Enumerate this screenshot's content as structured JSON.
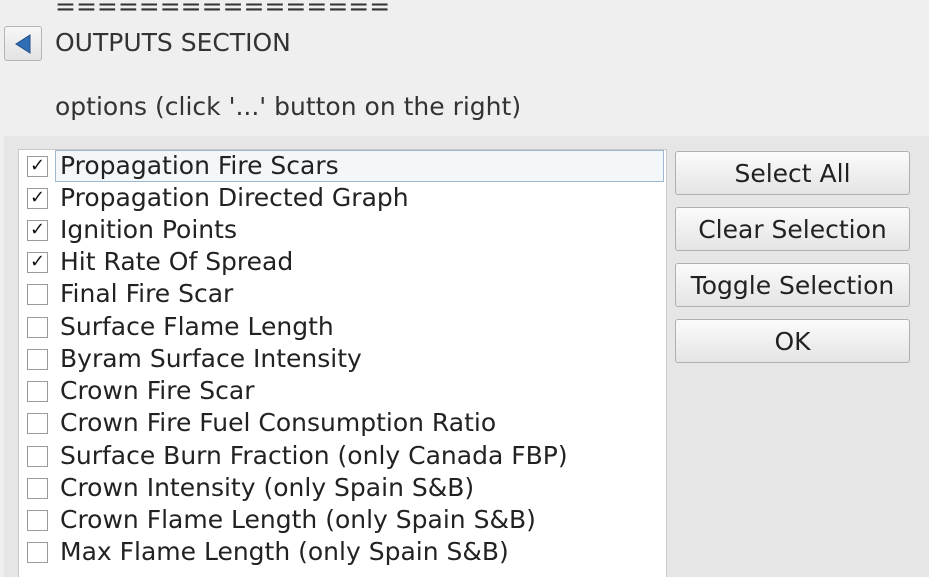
{
  "header": {
    "separator": "================",
    "back_icon": "back-arrow-icon",
    "title": "OUTPUTS SECTION",
    "hint": "options (click '...' button on the right)"
  },
  "options": {
    "items": [
      {
        "label": "Propagation Fire Scars",
        "checked": true
      },
      {
        "label": "Propagation Directed Graph",
        "checked": true
      },
      {
        "label": "Ignition Points",
        "checked": true
      },
      {
        "label": "Hit Rate Of Spread",
        "checked": true
      },
      {
        "label": "Final Fire Scar",
        "checked": false
      },
      {
        "label": "Surface Flame Length",
        "checked": false
      },
      {
        "label": "Byram Surface Intensity",
        "checked": false
      },
      {
        "label": "Crown Fire Scar",
        "checked": false
      },
      {
        "label": "Crown Fire Fuel Consumption Ratio",
        "checked": false
      },
      {
        "label": "Surface Burn Fraction (only Canada FBP)",
        "checked": false
      },
      {
        "label": "Crown Intensity (only Spain S&B)",
        "checked": false
      },
      {
        "label": "Crown Flame Length (only Spain S&B)",
        "checked": false
      },
      {
        "label": "Max Flame Length (only Spain S&B)",
        "checked": false
      }
    ],
    "check_mark": "✓"
  },
  "buttons": {
    "select_all": "Select All",
    "clear_selection": "Clear Selection",
    "toggle_selection": "Toggle Selection",
    "ok": "OK"
  },
  "colors": {
    "background": "#efefef",
    "panel": "#e6e6e6",
    "back_arrow": "#2f6db5",
    "focus_outline": "#9fb8cf"
  }
}
